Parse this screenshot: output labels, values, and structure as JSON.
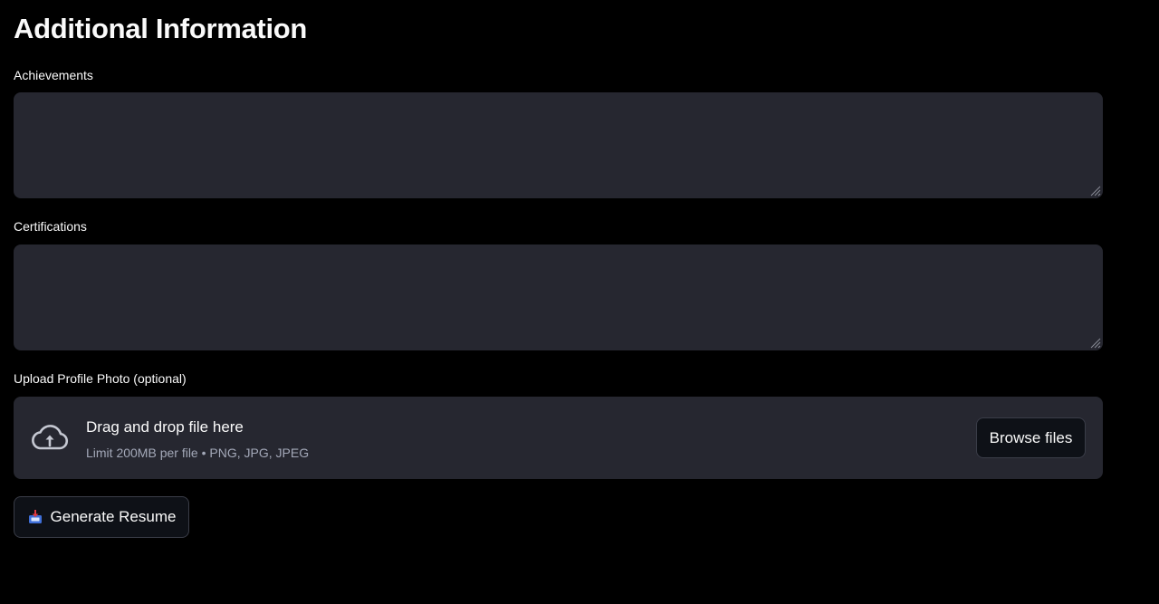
{
  "section": {
    "title": "Additional Information"
  },
  "fields": {
    "achievements": {
      "label": "Achievements",
      "value": ""
    },
    "certifications": {
      "label": "Certifications",
      "value": ""
    }
  },
  "upload": {
    "label": "Upload Profile Photo (optional)",
    "drop_text": "Drag and drop file here",
    "limit_text": "Limit 200MB per file • PNG, JPG, JPEG",
    "browse_label": "Browse files",
    "icon": "cloud-upload-icon"
  },
  "actions": {
    "generate_label": "Generate Resume",
    "generate_icon": "inbox-tray-icon"
  },
  "theme": {
    "background": "#000000",
    "input_bg": "#262730",
    "button_bg": "#0e1117",
    "text": "#fafafa",
    "muted_text": "#a3a8b8"
  }
}
